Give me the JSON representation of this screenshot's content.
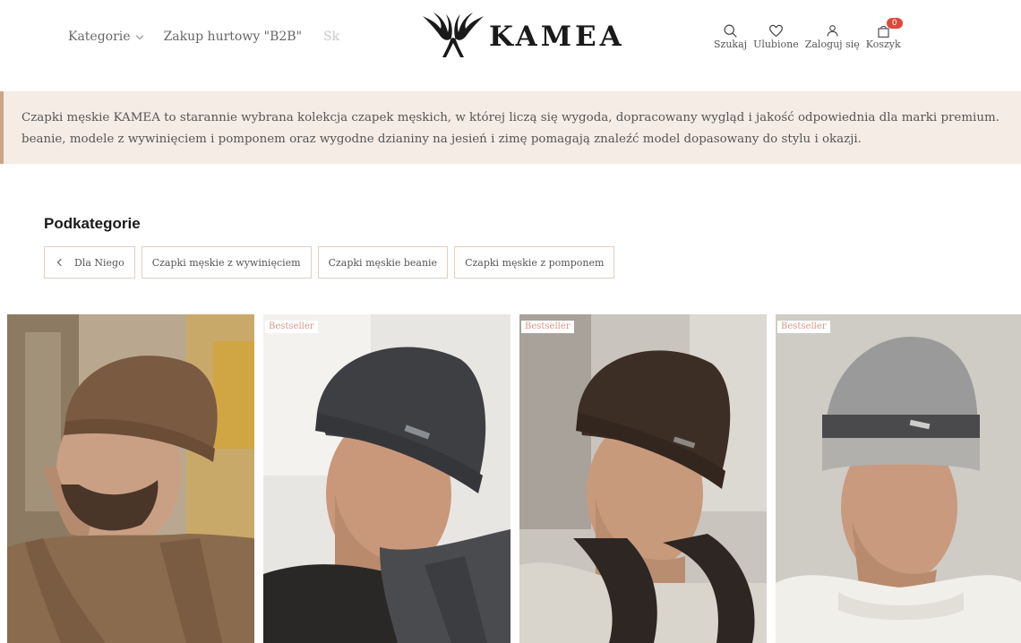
{
  "header": {
    "nav_left": [
      {
        "label": "Kategorie",
        "has_dropdown": true
      },
      {
        "label": "Zakup hurtowy \"B2B\"",
        "has_dropdown": false
      },
      {
        "label": "Sk",
        "has_dropdown": false
      }
    ],
    "logo_text": "KAMEA",
    "actions": [
      {
        "label": "Szukaj",
        "icon": "search-icon"
      },
      {
        "label": "Ulubione",
        "icon": "heart-icon"
      },
      {
        "label": "Zaloguj się",
        "icon": "user-icon"
      },
      {
        "label": "Koszyk",
        "icon": "bag-icon"
      }
    ],
    "cart_count": "0"
  },
  "banner": {
    "text": "Czapki męskie KAMEA to starannie wybrana kolekcja czapek męskich, w której liczą się wygoda, dopracowany wygląd i jakość odpowiednia dla marki premium. beanie, modele z wywinięciem i pomponem oraz wygodne dzianiny na jesień i zimę pomagają znaleźć model dopasowany do stylu i okazji."
  },
  "subcategories": {
    "title": "Podkategorie",
    "back_label": "Dla Niego",
    "items": [
      "Czapki męskie z wywinięciem",
      "Czapki męskie beanie",
      "Czapki męskie z pomponem"
    ]
  },
  "products": [
    {
      "badge": "",
      "hat_color": "#7a5a40",
      "scarf_color": "#8a6b4e"
    },
    {
      "badge": "Bestseller",
      "hat_color": "#3e3f42",
      "scarf_color": "#4a4b4e"
    },
    {
      "badge": "Bestseller",
      "hat_color": "#3d2e25",
      "scarf_color": "#2d2622"
    },
    {
      "badge": "Bestseller",
      "hat_color": "#9a9a9a",
      "scarf_color": "#f1efe9"
    }
  ],
  "colors": {
    "banner_bg": "#f5ece5",
    "banner_accent": "#c9a58a",
    "badge_text": "#d59a8b",
    "cart_badge": "#e0483c"
  }
}
